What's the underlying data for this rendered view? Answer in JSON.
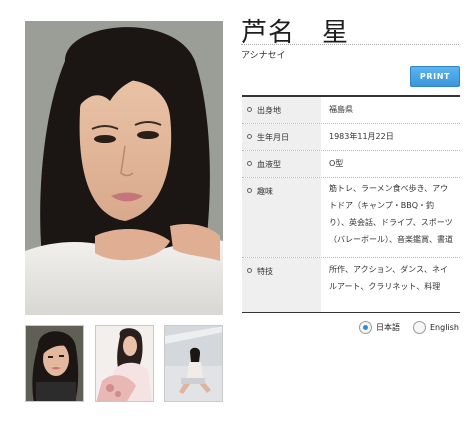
{
  "profile_header": {
    "name": "芦名　星",
    "kana": "アシナセイ",
    "print_label": "PRINT"
  },
  "profile_rows": [
    {
      "label": "出身地",
      "value": "福島県"
    },
    {
      "label": "生年月日",
      "value": "1983年11月22日"
    },
    {
      "label": "血液型",
      "value": "O型"
    },
    {
      "label": "趣味",
      "value": "筋トレ、ラーメン食べ歩き、アウトドア（キャンプ・BBQ・釣り）、英会話、ドライブ、スポーツ（バレーボール）、音楽鑑賞、書道"
    },
    {
      "label": "特技",
      "value": "所作、アクション、ダンス、ネイルアート、クラリネット、料理"
    }
  ],
  "language": {
    "options": [
      "日本語",
      "English"
    ],
    "selected": "日本語"
  },
  "images": {
    "main": "portrait-photo",
    "thumbnails": [
      "thumbnail-photo-1",
      "thumbnail-photo-2",
      "thumbnail-photo-3"
    ]
  }
}
